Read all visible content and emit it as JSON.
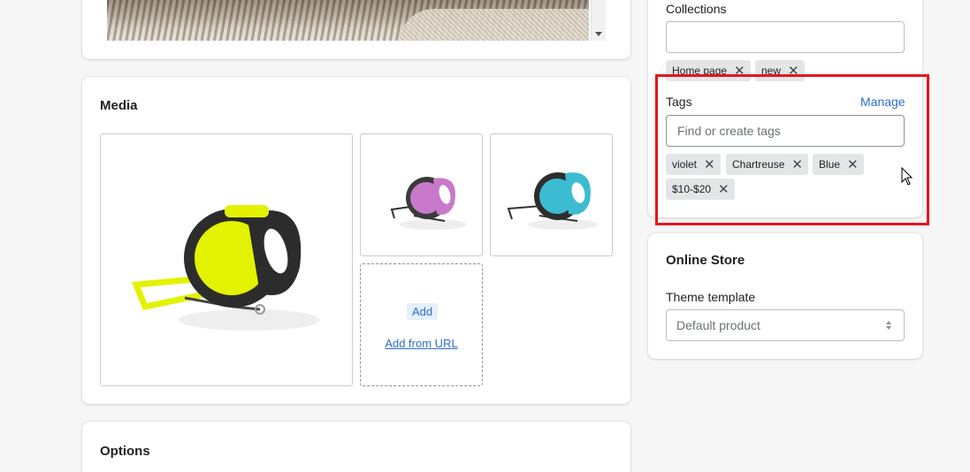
{
  "media": {
    "title": "Media",
    "add_label": "Add",
    "add_from_url_label": "Add from URL"
  },
  "options": {
    "title": "Options"
  },
  "organization": {
    "collections_label": "Collections",
    "collections": [
      "Home page",
      "new"
    ],
    "tags_label": "Tags",
    "manage_label": "Manage",
    "tags_placeholder": "Find or create tags",
    "tags": [
      "violet",
      "Chartreuse",
      "Blue",
      "$10-$20"
    ]
  },
  "online_store": {
    "title": "Online Store",
    "theme_label": "Theme template",
    "theme_value": "Default product"
  },
  "colors": {
    "accent": "#2c6ecb",
    "highlight": "#e8141b",
    "leash_yellow": "#e3f200",
    "leash_pink": "#c879c9",
    "leash_teal": "#3bbcd2"
  },
  "icons": [
    "remove-tag-icon",
    "select-arrows-icon",
    "mouse-cursor-icon",
    "dropdown-arrow-icon"
  ]
}
